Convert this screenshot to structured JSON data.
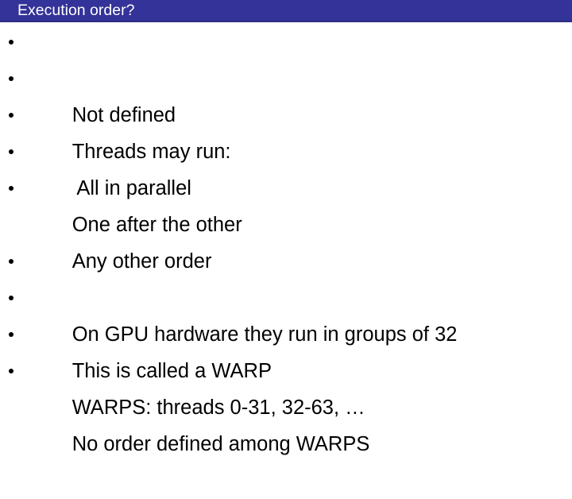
{
  "slide": {
    "title": "Execution order?",
    "title_bar_color": "#333399",
    "title_text_color": "#ffffff",
    "background_color": "#ffffff",
    "body_text_color": "#000000",
    "bullet_glyph": "bullet-dot"
  },
  "groups": [
    {
      "name": "execution-order-group",
      "items": [
        {
          "text": "Not defined"
        },
        {
          "text": "Threads may run:"
        },
        {
          "text": " All in parallel"
        },
        {
          "text": "One after the other"
        },
        {
          "text": "Any other order"
        }
      ]
    },
    {
      "name": "warp-group",
      "items": [
        {
          "text": "On GPU hardware they run in groups of 32"
        },
        {
          "text": "This is called a WARP"
        },
        {
          "text": "WARPS: threads 0-31, 32-63, …"
        },
        {
          "text": "No order defined among WARPS"
        }
      ]
    }
  ]
}
